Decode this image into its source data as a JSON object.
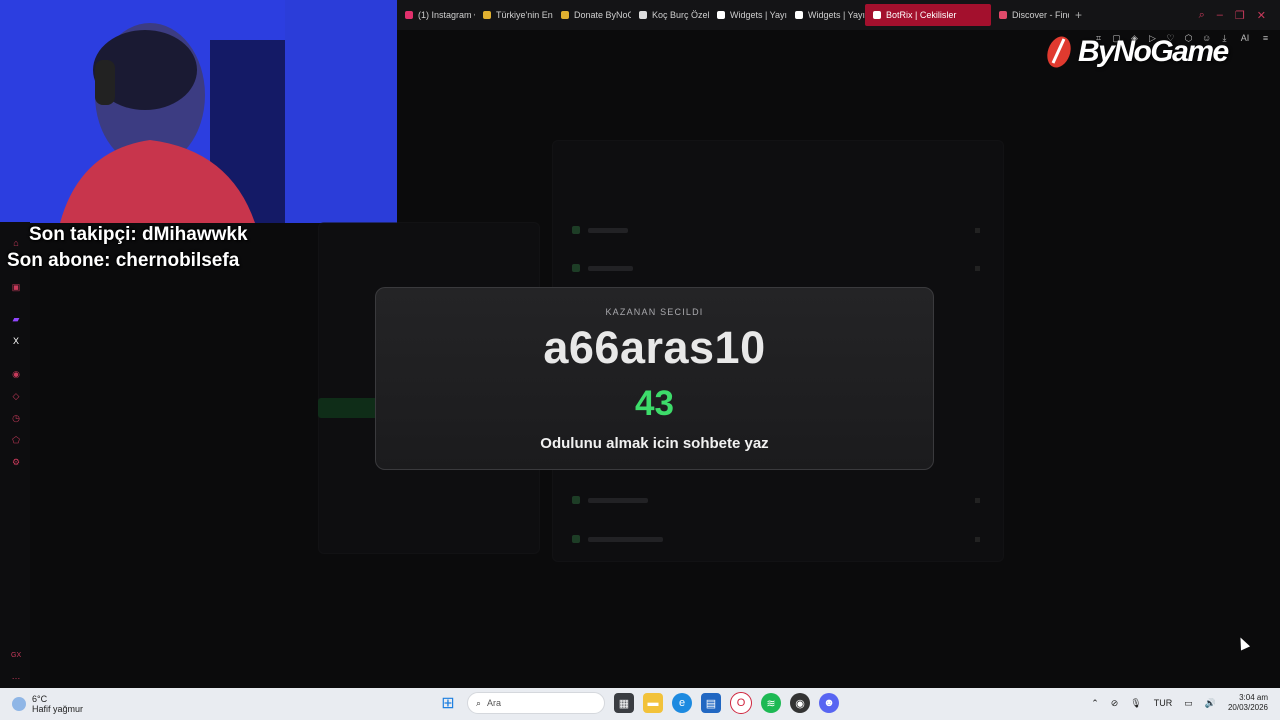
{
  "browser": {
    "tabs": [
      {
        "label": "(1) Instagram • ",
        "color": "#e1306c"
      },
      {
        "label": "Türkiye'nin En B",
        "color": "#e0b030"
      },
      {
        "label": "Donate ByNoGa",
        "color": "#e0b030"
      },
      {
        "label": "Koç Burç Özelli",
        "color": "#ffffff"
      },
      {
        "label": "Widgets | Yayın",
        "color": "#ffffff"
      },
      {
        "label": "Widgets | Yayın",
        "color": "#ffffff"
      }
    ],
    "active_tab": {
      "label": "BotRix | Cekilisler",
      "color": "#ffffff"
    },
    "extra_tab": {
      "label": "Discover - Find",
      "color": "#e04a6a"
    },
    "toolbar_ai_label": "AI"
  },
  "overlay": {
    "follower_text": "Son takipçi: dMihawwkk",
    "subscriber_text": "Son abone: chernobilsefa",
    "logo_text": "ByNoGame"
  },
  "giveaway": {
    "caption": "KAZANAN SECILDI",
    "winner_name": "a66aras10",
    "number": "43",
    "message": "Odulunu almak icin sohbete yaz"
  },
  "rail": {
    "bottom_label": "GX"
  },
  "taskbar": {
    "weather_temp": "6°C",
    "weather_desc": "Hafif yağmur",
    "search_placeholder": "Ara",
    "language": "TUR",
    "time": "3:04 am",
    "date": "20/03/2026"
  },
  "colors": {
    "accent": "#a3102d",
    "winner_number": "#3ddc6a"
  }
}
